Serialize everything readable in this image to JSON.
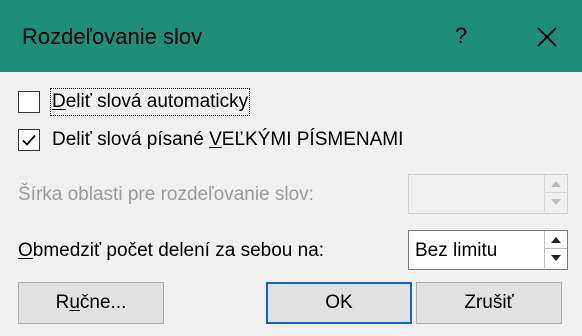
{
  "dialog": {
    "title": "Rozdeľovanie slov",
    "help_label": "?",
    "close_icon": "close-icon",
    "title_bar_color": "#1e8d79"
  },
  "options": {
    "auto_hyphenate": {
      "label_accel": "D",
      "label_rest": "eliť slová automaticky",
      "checked": false
    },
    "hyphenate_caps": {
      "label_prefix": "Deliť slová písané ",
      "label_accel": "V",
      "label_rest": "EĽKÝMI PÍSMENAMI",
      "checked": true
    }
  },
  "hyphenation_zone": {
    "label": "Šírka oblasti pre rozdeľovanie slov:",
    "value": "",
    "disabled": true
  },
  "consecutive_limit": {
    "label_accel": "O",
    "label_rest": "bmedziť počet delení za sebou na:",
    "value": "Bez limitu"
  },
  "buttons": {
    "manual": {
      "label_prefix": "R",
      "label_accel": "u",
      "label_rest": "čne..."
    },
    "ok": "OK",
    "cancel": "Zrušiť"
  }
}
